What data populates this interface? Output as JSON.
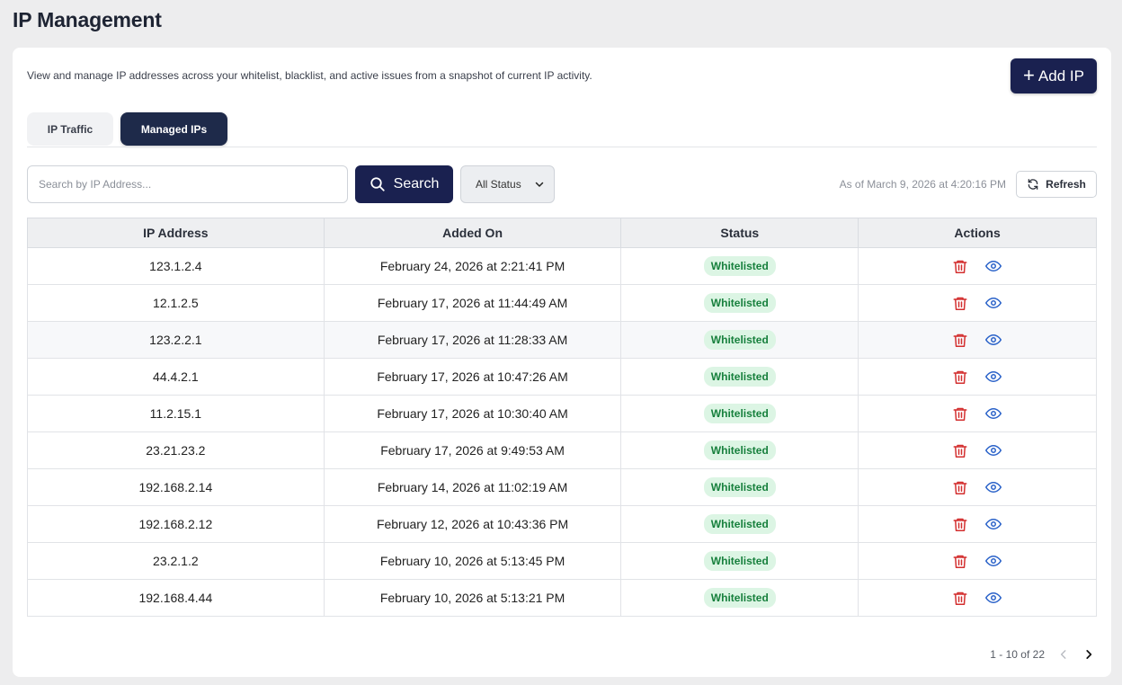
{
  "page": {
    "title": "IP Management"
  },
  "card": {
    "description": "View and manage IP addresses across your whitelist, blacklist, and active issues from a snapshot of current IP activity.",
    "add_button": "Add IP"
  },
  "tabs": [
    {
      "label": "IP Traffic",
      "active": false
    },
    {
      "label": "Managed IPs",
      "active": true
    }
  ],
  "toolbar": {
    "search_placeholder": "Search by IP Address...",
    "search_value": "",
    "search_button": "Search",
    "status_filter": "All Status",
    "timestamp": "As of March 9, 2026 at 4:20:16 PM",
    "refresh_button": "Refresh"
  },
  "table": {
    "headers": [
      "IP Address",
      "Added On",
      "Status",
      "Actions"
    ],
    "rows": [
      {
        "ip": "123.1.2.4",
        "added_on": "February 24, 2026 at 2:21:41 PM",
        "status": "Whitelisted"
      },
      {
        "ip": "12.1.2.5",
        "added_on": "February 17, 2026 at 11:44:49 AM",
        "status": "Whitelisted"
      },
      {
        "ip": "123.2.2.1",
        "added_on": "February 17, 2026 at 11:28:33 AM",
        "status": "Whitelisted"
      },
      {
        "ip": "44.4.2.1",
        "added_on": "February 17, 2026 at 10:47:26 AM",
        "status": "Whitelisted"
      },
      {
        "ip": "11.2.15.1",
        "added_on": "February 17, 2026 at 10:30:40 AM",
        "status": "Whitelisted"
      },
      {
        "ip": "23.21.23.2",
        "added_on": "February 17, 2026 at 9:49:53 AM",
        "status": "Whitelisted"
      },
      {
        "ip": "192.168.2.14",
        "added_on": "February 14, 2026 at 11:02:19 AM",
        "status": "Whitelisted"
      },
      {
        "ip": "192.168.2.12",
        "added_on": "February 12, 2026 at 10:43:36 PM",
        "status": "Whitelisted"
      },
      {
        "ip": "23.2.1.2",
        "added_on": "February 10, 2026 at 5:13:45 PM",
        "status": "Whitelisted"
      },
      {
        "ip": "192.168.4.44",
        "added_on": "February 10, 2026 at 5:13:21 PM",
        "status": "Whitelisted"
      }
    ]
  },
  "pagination": {
    "range": "1 - 10 of 22"
  },
  "icons": {
    "add": "plus-icon",
    "search": "search-icon",
    "select": "chevron-down-icon",
    "refresh": "refresh-icon",
    "delete": "trash-icon",
    "view": "eye-icon",
    "prev": "chevron-left-icon",
    "next": "chevron-right-icon"
  },
  "colors": {
    "primary": "#1a2150",
    "tab_active": "#1e2a4a",
    "badge_bg": "#dcf5e4",
    "badge_text": "#17803d",
    "delete": "#d32f2f",
    "view": "#2a62c9"
  }
}
